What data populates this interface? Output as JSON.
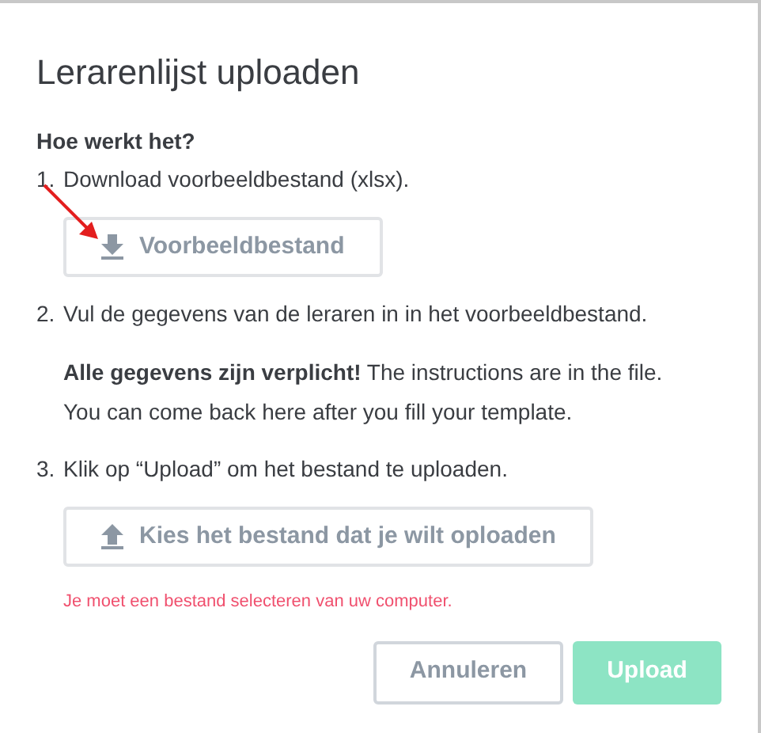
{
  "dialog": {
    "title": "Lerarenlijst uploaden",
    "heading": "Hoe werkt het?",
    "steps": [
      {
        "number": "1.",
        "text": "Download voorbeeldbestand (xlsx).",
        "button": {
          "label": "Voorbeeldbestand",
          "kind": "download"
        }
      },
      {
        "number": "2.",
        "text": "Vul de gegevens van de leraren in in het voorbeeldbestand.",
        "note": "**Alle gegevens zijn verplicht!**  The instructions are in the file. You can come back here after you fill your template."
      },
      {
        "number": "3.",
        "text": "Klik op “Upload” om het bestand te uploaden.",
        "button": {
          "label": "Kies het bestand dat je wilt oploaden",
          "kind": "upload"
        }
      }
    ],
    "error": "Je moet een bestand selecteren van uw computer.",
    "buttons": [
      {
        "label": "Annuleren",
        "kind": "secondary",
        "disabled": false
      },
      {
        "label": "Upload",
        "kind": "primary",
        "disabled": true
      }
    ]
  }
}
